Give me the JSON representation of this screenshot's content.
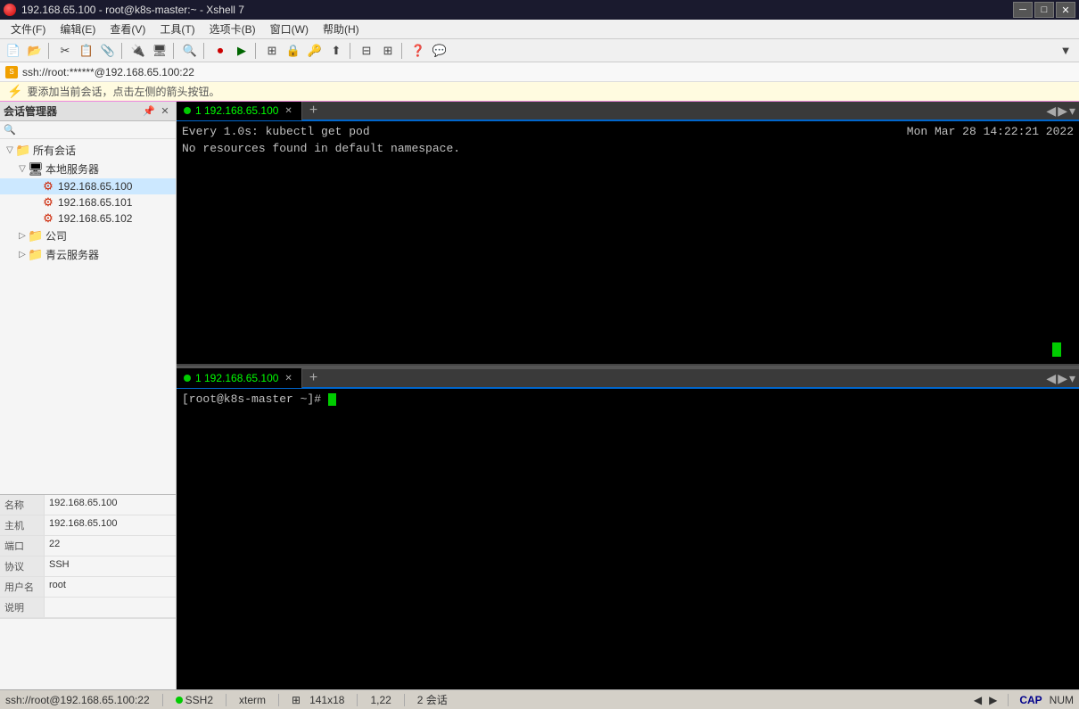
{
  "titlebar": {
    "title": "192.168.65.100 - root@k8s-master:~ - Xshell 7",
    "min_btn": "─",
    "max_btn": "□",
    "close_btn": "✕"
  },
  "menubar": {
    "items": [
      {
        "label": "文件(F)"
      },
      {
        "label": "编辑(E)"
      },
      {
        "label": "查看(V)"
      },
      {
        "label": "工具(T)"
      },
      {
        "label": "选项卡(B)"
      },
      {
        "label": "窗口(W)"
      },
      {
        "label": "帮助(H)"
      }
    ]
  },
  "addressbar": {
    "text": "ssh://root:******@192.168.65.100:22"
  },
  "infobar": {
    "text": "要添加当前会话，点击左侧的箭头按钮。"
  },
  "sidebar": {
    "title": "会话管理器",
    "tree": [
      {
        "label": "所有会话",
        "level": 0,
        "expand": "□",
        "type": "folder"
      },
      {
        "label": "本地服务器",
        "level": 1,
        "expand": "□",
        "type": "server"
      },
      {
        "label": "192.168.65.100",
        "level": 2,
        "expand": "",
        "type": "conn"
      },
      {
        "label": "192.168.65.101",
        "level": 2,
        "expand": "",
        "type": "conn"
      },
      {
        "label": "192.168.65.102",
        "level": 2,
        "expand": "",
        "type": "conn"
      },
      {
        "label": "公司",
        "level": 1,
        "expand": "＋",
        "type": "folder"
      },
      {
        "label": "青云服务器",
        "level": 1,
        "expand": "＋",
        "type": "folder"
      }
    ],
    "session_info": [
      {
        "key": "名称",
        "value": "192.168.65.100"
      },
      {
        "key": "主机",
        "value": "192.168.65.100"
      },
      {
        "key": "端口",
        "value": "22"
      },
      {
        "key": "协议",
        "value": "SSH"
      },
      {
        "key": "用户名",
        "value": "root"
      },
      {
        "key": "说明",
        "value": ""
      }
    ]
  },
  "terminal_top": {
    "tab_label": "1 192.168.65.100",
    "command": "Every 1.0s: kubectl get pod",
    "timestamp": "Mon Mar 28 14:22:21 2022",
    "output": "No resources found in default namespace."
  },
  "terminal_bottom": {
    "tab_label": "1 192.168.65.100",
    "prompt": "[root@k8s-master ~]# "
  },
  "statusbar": {
    "ssh_text": "SSH2",
    "term_text": "xterm",
    "size_text": "141x18",
    "pos_text": "1,22",
    "session_count": "2 会话",
    "cap_text": "CAP",
    "num_text": "NUM",
    "status_left": "ssh://root@192.168.65.100:22"
  }
}
